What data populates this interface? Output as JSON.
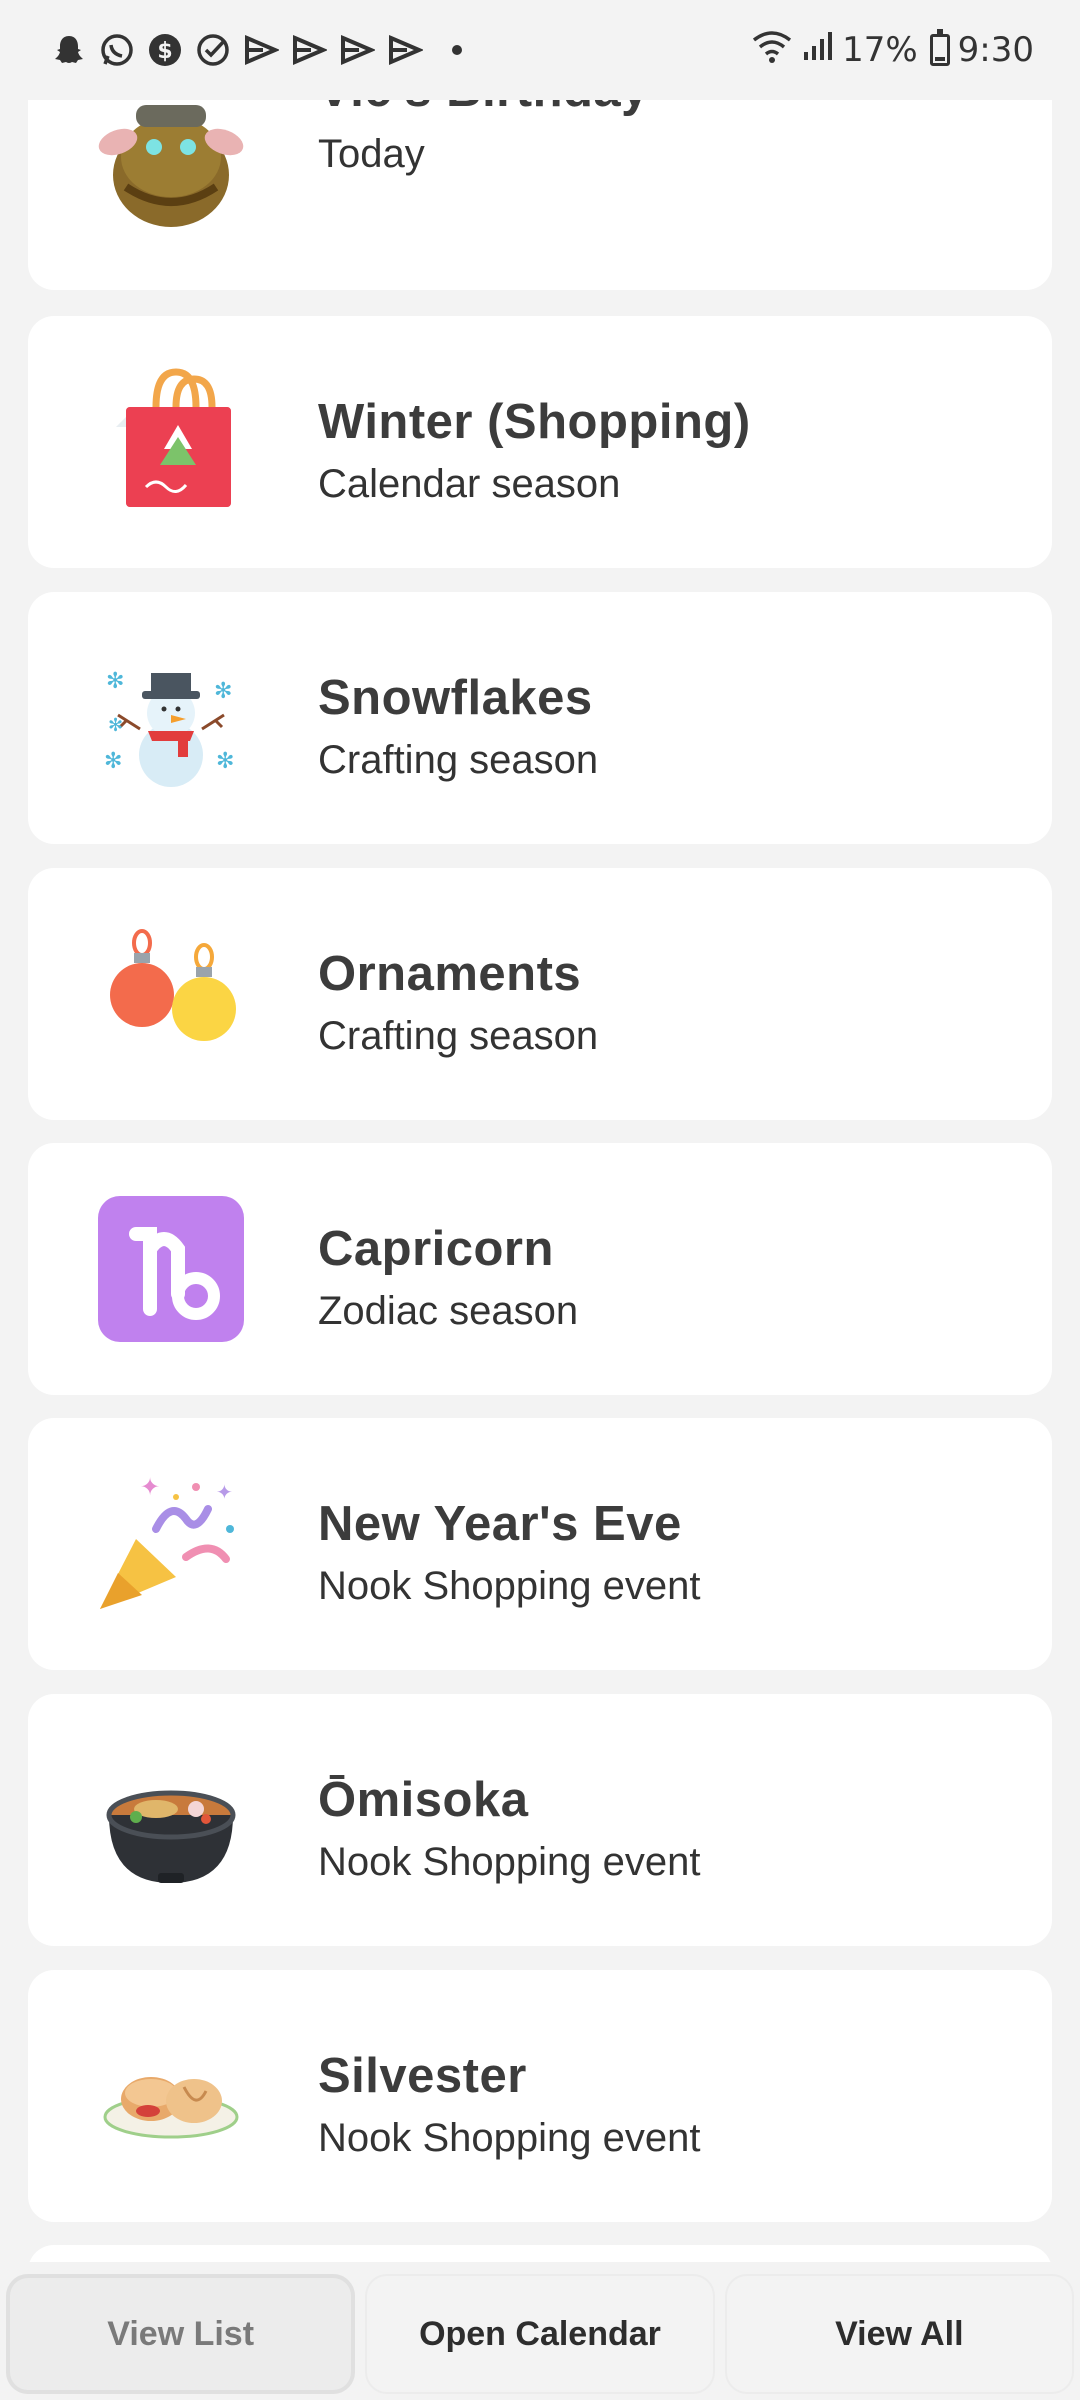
{
  "status_bar": {
    "battery": "17%",
    "time": "9:30",
    "battery_level": 0.17,
    "icons": [
      "snapchat-icon",
      "whatsapp-icon",
      "cash-icon",
      "check-circle-icon",
      "play-icon",
      "play-icon",
      "play-icon",
      "play-icon"
    ]
  },
  "events": [
    {
      "title": "Vic's Birthday",
      "subtitle": "Today",
      "icon": "villager-vic-icon"
    },
    {
      "title": "Winter (Shopping)",
      "subtitle": "Calendar season",
      "icon": "shopping-bag-icon"
    },
    {
      "title": "Snowflakes",
      "subtitle": "Crafting season",
      "icon": "snowman-icon"
    },
    {
      "title": "Ornaments",
      "subtitle": "Crafting season",
      "icon": "ornaments-icon"
    },
    {
      "title": "Capricorn",
      "subtitle": "Zodiac season",
      "icon": "capricorn-icon"
    },
    {
      "title": "New Year's Eve",
      "subtitle": "Nook Shopping event",
      "icon": "party-popper-icon"
    },
    {
      "title": "Ōmisoka",
      "subtitle": "Nook Shopping event",
      "icon": "noodle-bowl-icon"
    },
    {
      "title": "Silvester",
      "subtitle": "Nook Shopping event",
      "icon": "pastries-icon"
    }
  ],
  "bottom_bar": {
    "view_list": "View List",
    "open_calendar": "Open Calendar",
    "view_all": "View All"
  }
}
